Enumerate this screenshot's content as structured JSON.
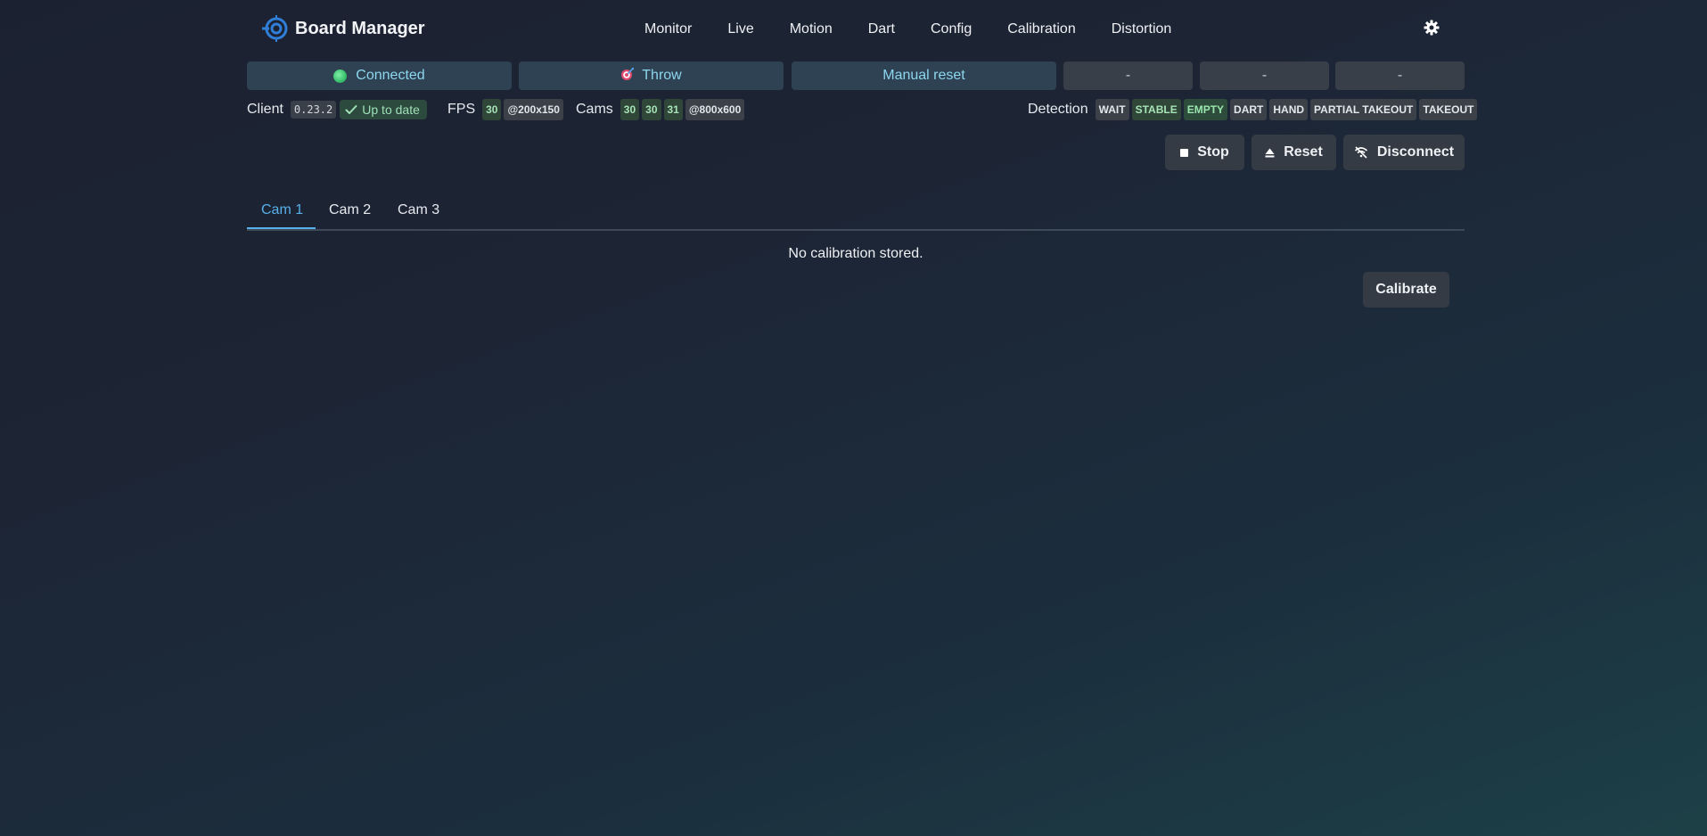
{
  "header": {
    "app_title": "Board Manager",
    "nav": [
      "Monitor",
      "Live",
      "Motion",
      "Dart",
      "Config",
      "Calibration",
      "Distortion"
    ],
    "settings_icon": "gear-icon"
  },
  "status": {
    "connection": "Connected",
    "mode": "Throw",
    "reset_mode": "Manual reset",
    "slot_1": "-",
    "slot_2": "-",
    "slot_3": "-"
  },
  "info": {
    "client_label": "Client",
    "client_version": "0.23.2",
    "update_status": "Up to date",
    "fps_label": "FPS",
    "fps_value": "30",
    "fps_resolution": "@200x150",
    "cams_label": "Cams",
    "cam_fps": [
      "30",
      "30",
      "31"
    ],
    "cams_resolution": "@800x600",
    "detection_label": "Detection",
    "detection_states": [
      "WAIT",
      "STABLE",
      "EMPTY",
      "DART",
      "HAND",
      "PARTIAL TAKEOUT",
      "TAKEOUT"
    ]
  },
  "actions": {
    "stop": "Stop",
    "reset": "Reset",
    "disconnect": "Disconnect"
  },
  "tabs": [
    "Cam 1",
    "Cam 2",
    "Cam 3"
  ],
  "active_tab": "Cam 1",
  "content": {
    "message": "No calibration stored.",
    "calibrate": "Calibrate"
  },
  "colors": {
    "accent": "#57b0ea",
    "status_blue_text": "#8cd6ee",
    "ok_green": "#9fe0b7"
  }
}
